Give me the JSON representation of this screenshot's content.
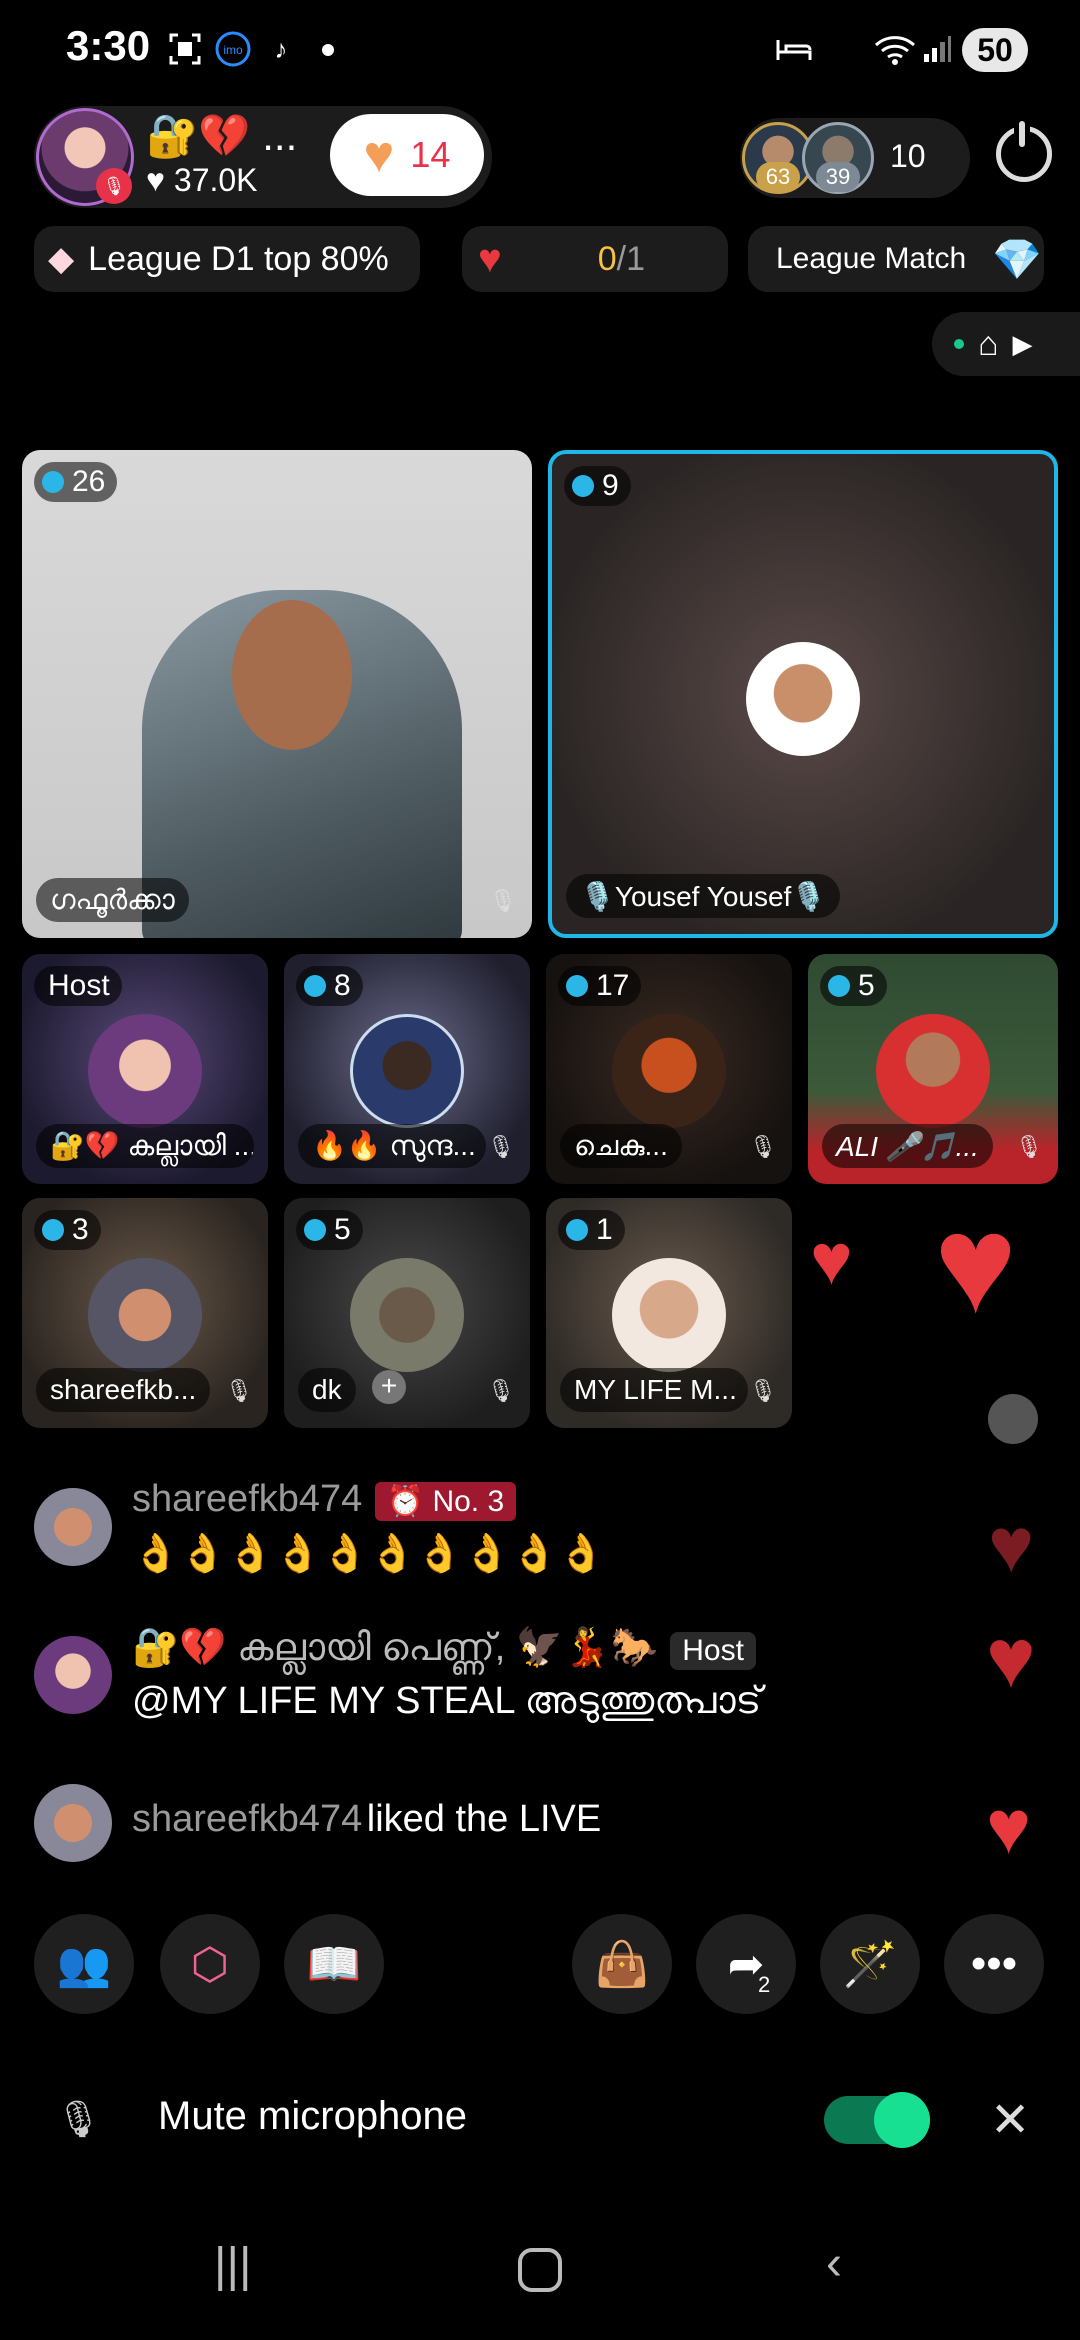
{
  "status_bar": {
    "time": "3:30",
    "battery": "50"
  },
  "host": {
    "name_emoji": "🔐💔 ...",
    "likes": "♥ 37.0K",
    "like_count": "14"
  },
  "viewers": {
    "badge1": "63",
    "badge2": "39",
    "count": "10"
  },
  "league": {
    "rank": "League D1 top 80%",
    "progress_current": "0",
    "progress_total": "/1",
    "match_label": "League Match"
  },
  "tiles": [
    {
      "level": "26",
      "name": "ഗഫൂർക്കാ"
    },
    {
      "level": "9",
      "name": "🎙️Yousef Yousef🎙️"
    },
    {
      "level": "Host",
      "name": "🔐💔 കല്ലായി ..."
    },
    {
      "level": "8",
      "name": "🔥🔥 സുന്ദ..."
    },
    {
      "level": "17",
      "name": "ചെകു..."
    },
    {
      "level": "5",
      "name": "ALI 🎤🎵..."
    },
    {
      "level": "3",
      "name": "shareefkb..."
    },
    {
      "level": "5",
      "name": "dk"
    },
    {
      "level": "1",
      "name": "MY LIFE M..."
    }
  ],
  "chat": [
    {
      "user": "shareefkb474",
      "badge": "No. 3",
      "text": "👌👌👌👌👌👌👌👌👌👌"
    },
    {
      "user": "🔐💔 കല്ലായി പെണ്ണ്, 🦅💃🐎",
      "tag": "Host",
      "text": "@MY LIFE MY STEAL അടുത്തുത്പാട്"
    },
    {
      "user": "shareefkb474",
      "text": "liked the LIVE"
    }
  ],
  "share_count": "2",
  "mute": {
    "label": "Mute microphone",
    "enabled": true
  }
}
